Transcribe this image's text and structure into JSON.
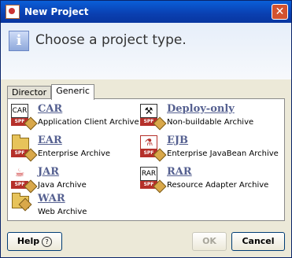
{
  "window": {
    "title": "New Project",
    "close_label": "✕"
  },
  "header": {
    "title": "Choose a project type.",
    "info_icon": "info-icon"
  },
  "tabs": [
    {
      "label": "Director"
    },
    {
      "label": "Generic"
    }
  ],
  "selected_tab": "Generic",
  "project_types": [
    {
      "name": "CAR",
      "description": "Application Client Archive",
      "icon": "car-icon",
      "icon_text": "CAR"
    },
    {
      "name": "Deploy-only",
      "description": "Non-buildable Archive",
      "icon": "deploy-only-icon"
    },
    {
      "name": "EAR",
      "description": "Enterprise Archive",
      "icon": "ear-icon"
    },
    {
      "name": "EJB",
      "description": "Enterprise JavaBean Archive",
      "icon": "ejb-icon"
    },
    {
      "name": "JAR",
      "description": "Java Archive",
      "icon": "jar-icon"
    },
    {
      "name": "RAR",
      "description": "Resource Adapter Archive",
      "icon": "rar-icon",
      "icon_text": "RAR"
    },
    {
      "name": "WAR",
      "description": "Web Archive",
      "icon": "war-icon"
    }
  ],
  "spf_badge": "SPF",
  "buttons": {
    "help": "Help",
    "ok": "OK",
    "cancel": "Cancel"
  },
  "colors": {
    "title_bar": "#0a4fc8",
    "link": "#556090",
    "close_button": "#d3522f"
  }
}
